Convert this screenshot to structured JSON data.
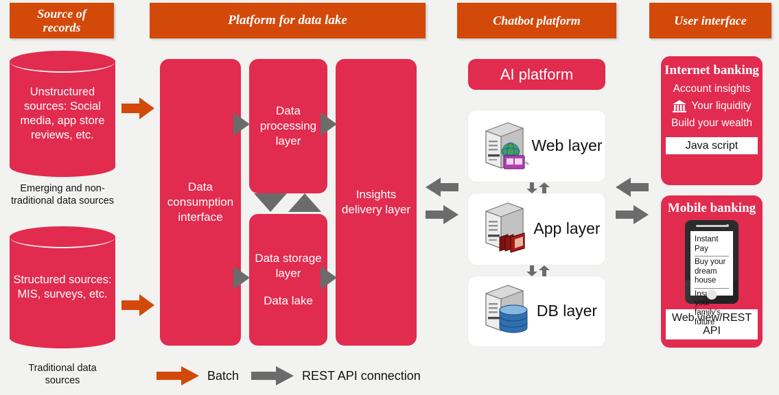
{
  "colors": {
    "background": "#f2f2f0",
    "banner_orange": "#d2490a",
    "accent_red": "#e12b4f",
    "arrow_gray": "#6b6b6b",
    "arrow_orange": "#d2490a",
    "white": "#ffffff",
    "text_dark": "#111111"
  },
  "headers": {
    "source_of_records": "Source of\nrecords",
    "source_of_records_line1": "Source of",
    "source_of_records_line2": "records",
    "platform": "Platform for data lake",
    "chatbot": "Chatbot platform",
    "user_interface": "User interface"
  },
  "sources": {
    "unstructured": {
      "text": "Unstructured sources: Social media, app store reviews, etc.",
      "caption": "Emerging and non-traditional data sources"
    },
    "structured": {
      "text": "Structured sources: MIS, surveys, etc.",
      "caption": "Traditional data sources"
    }
  },
  "platform": {
    "consumption": "Data consumption interface",
    "processing": "Data processing layer",
    "storage_line1": "Data storage layer",
    "storage_line2": "Data lake",
    "insights": "Insights delivery layer"
  },
  "chatbot": {
    "ai_platform": "AI platform",
    "layers": [
      {
        "label": "Web layer",
        "icon": "server-web-icon"
      },
      {
        "label": "App layer",
        "icon": "server-app-icon"
      },
      {
        "label": "DB layer",
        "icon": "server-db-icon"
      }
    ]
  },
  "user_interface": {
    "internet_banking": {
      "title": "Internet banking",
      "items": [
        "Account insights",
        "Your liquidity",
        "Build your wealth"
      ],
      "bank_icon": "bank-building-icon",
      "tech_chip": "Java script"
    },
    "mobile_banking": {
      "title": "Mobile banking",
      "screen_items": [
        "Instant Pay",
        "Buy your dream house",
        "Insure your family's future"
      ],
      "tech_chip": "Web view/REST API"
    }
  },
  "legend": {
    "batch": "Batch",
    "rest": "REST API connection"
  }
}
